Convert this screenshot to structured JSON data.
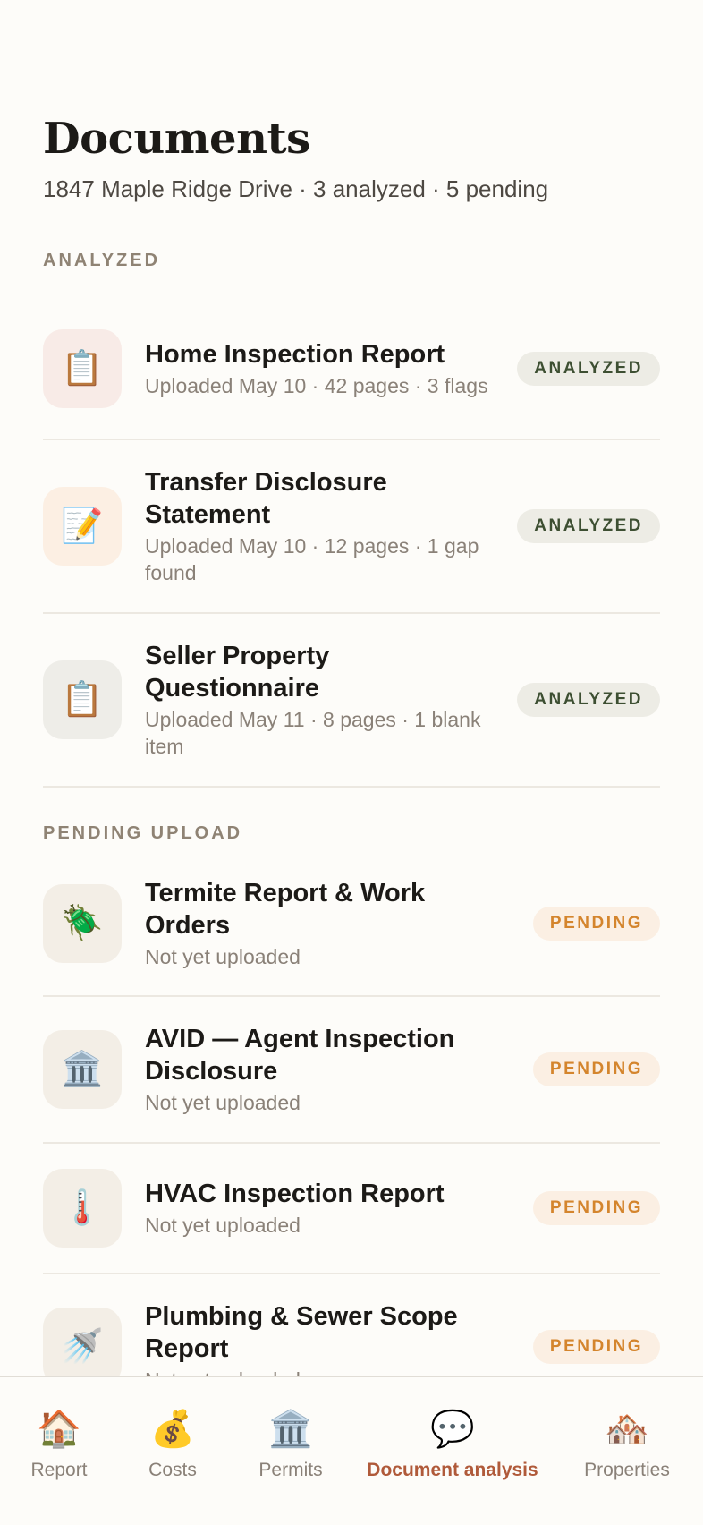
{
  "header": {
    "title": "Documents",
    "subtitle": "1847 Maple Ridge Drive · 3 analyzed · 5 pending"
  },
  "sections": {
    "analyzed": {
      "label": "ANALYZED",
      "items": [
        {
          "name": "Home Inspection Report",
          "meta": "Uploaded May 10 · 42 pages · 3 flags",
          "status": "ANALYZED",
          "icon": "clipboard-icon",
          "glyph": "📋",
          "tile_color": "#f8ebe7"
        },
        {
          "name": "Transfer Disclosure Statement",
          "meta": "Uploaded May 10 · 12 pages · 1 gap found",
          "status": "ANALYZED",
          "icon": "memo-icon",
          "glyph": "📝",
          "tile_color": "#fcefe3"
        },
        {
          "name": "Seller Property Questionnaire",
          "meta": "Uploaded May 11 · 8 pages · 1 blank item",
          "status": "ANALYZED",
          "icon": "clipboard-icon",
          "glyph": "📋",
          "tile_color": "#eeede8"
        }
      ]
    },
    "pending": {
      "label": "PENDING UPLOAD",
      "items": [
        {
          "name": "Termite Report & Work Orders",
          "meta": "Not yet uploaded",
          "status": "PENDING",
          "icon": "beetle-icon",
          "glyph": "🪲",
          "tile_color": "#f3eee6"
        },
        {
          "name": "AVID — Agent Inspection Disclosure",
          "meta": "Not yet uploaded",
          "status": "PENDING",
          "icon": "classical-building-icon",
          "glyph": "🏛️",
          "tile_color": "#f3eee6"
        },
        {
          "name": "HVAC Inspection Report",
          "meta": "Not yet uploaded",
          "status": "PENDING",
          "icon": "thermometer-icon",
          "glyph": "🌡️",
          "tile_color": "#f3eee6"
        },
        {
          "name": "Plumbing & Sewer Scope Report",
          "meta": "Not yet uploaded",
          "status": "PENDING",
          "icon": "shower-icon",
          "glyph": "🚿",
          "tile_color": "#f3eee6"
        }
      ]
    }
  },
  "tabbar": {
    "tabs": [
      {
        "label": "Report",
        "icon": "house-icon",
        "glyph": "🏠",
        "active": false
      },
      {
        "label": "Costs",
        "icon": "money-bag-icon",
        "glyph": "💰",
        "active": false
      },
      {
        "label": "Permits",
        "icon": "classical-building-icon",
        "glyph": "🏛️",
        "active": false
      },
      {
        "label": "Document analysis",
        "icon": "speech-bubble-icon",
        "glyph": "💬",
        "active": true
      },
      {
        "label": "Properties",
        "icon": "houses-icon",
        "glyph": "🏘️",
        "active": false
      }
    ],
    "active_color": "#b05a3a"
  },
  "colors": {
    "background": "#fdfcf9",
    "analyzed_badge_text": "#3d4f32",
    "pending_badge_text": "#d4852d"
  }
}
